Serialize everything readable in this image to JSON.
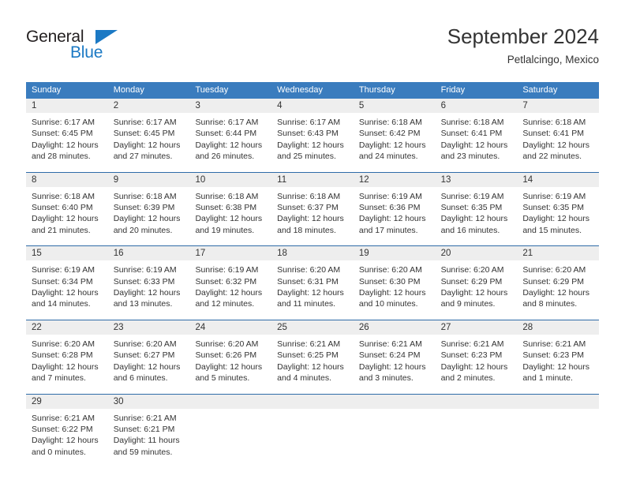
{
  "brand": {
    "name_part1": "General",
    "name_part2": "Blue",
    "logo_icon": "triangle-flag-icon",
    "accent_color": "#1b79c4"
  },
  "header": {
    "title": "September 2024",
    "location": "Petlalcingo, Mexico"
  },
  "calendar": {
    "header_bg_color": "#3a7cbe",
    "day_strip_color": "#eeeeee",
    "weekdays": [
      "Sunday",
      "Monday",
      "Tuesday",
      "Wednesday",
      "Thursday",
      "Friday",
      "Saturday"
    ],
    "weeks": [
      [
        {
          "date": "1",
          "lines": [
            "Sunrise: 6:17 AM",
            "Sunset: 6:45 PM",
            "Daylight: 12 hours",
            "and 28 minutes."
          ]
        },
        {
          "date": "2",
          "lines": [
            "Sunrise: 6:17 AM",
            "Sunset: 6:45 PM",
            "Daylight: 12 hours",
            "and 27 minutes."
          ]
        },
        {
          "date": "3",
          "lines": [
            "Sunrise: 6:17 AM",
            "Sunset: 6:44 PM",
            "Daylight: 12 hours",
            "and 26 minutes."
          ]
        },
        {
          "date": "4",
          "lines": [
            "Sunrise: 6:17 AM",
            "Sunset: 6:43 PM",
            "Daylight: 12 hours",
            "and 25 minutes."
          ]
        },
        {
          "date": "5",
          "lines": [
            "Sunrise: 6:18 AM",
            "Sunset: 6:42 PM",
            "Daylight: 12 hours",
            "and 24 minutes."
          ]
        },
        {
          "date": "6",
          "lines": [
            "Sunrise: 6:18 AM",
            "Sunset: 6:41 PM",
            "Daylight: 12 hours",
            "and 23 minutes."
          ]
        },
        {
          "date": "7",
          "lines": [
            "Sunrise: 6:18 AM",
            "Sunset: 6:41 PM",
            "Daylight: 12 hours",
            "and 22 minutes."
          ]
        }
      ],
      [
        {
          "date": "8",
          "lines": [
            "Sunrise: 6:18 AM",
            "Sunset: 6:40 PM",
            "Daylight: 12 hours",
            "and 21 minutes."
          ]
        },
        {
          "date": "9",
          "lines": [
            "Sunrise: 6:18 AM",
            "Sunset: 6:39 PM",
            "Daylight: 12 hours",
            "and 20 minutes."
          ]
        },
        {
          "date": "10",
          "lines": [
            "Sunrise: 6:18 AM",
            "Sunset: 6:38 PM",
            "Daylight: 12 hours",
            "and 19 minutes."
          ]
        },
        {
          "date": "11",
          "lines": [
            "Sunrise: 6:18 AM",
            "Sunset: 6:37 PM",
            "Daylight: 12 hours",
            "and 18 minutes."
          ]
        },
        {
          "date": "12",
          "lines": [
            "Sunrise: 6:19 AM",
            "Sunset: 6:36 PM",
            "Daylight: 12 hours",
            "and 17 minutes."
          ]
        },
        {
          "date": "13",
          "lines": [
            "Sunrise: 6:19 AM",
            "Sunset: 6:35 PM",
            "Daylight: 12 hours",
            "and 16 minutes."
          ]
        },
        {
          "date": "14",
          "lines": [
            "Sunrise: 6:19 AM",
            "Sunset: 6:35 PM",
            "Daylight: 12 hours",
            "and 15 minutes."
          ]
        }
      ],
      [
        {
          "date": "15",
          "lines": [
            "Sunrise: 6:19 AM",
            "Sunset: 6:34 PM",
            "Daylight: 12 hours",
            "and 14 minutes."
          ]
        },
        {
          "date": "16",
          "lines": [
            "Sunrise: 6:19 AM",
            "Sunset: 6:33 PM",
            "Daylight: 12 hours",
            "and 13 minutes."
          ]
        },
        {
          "date": "17",
          "lines": [
            "Sunrise: 6:19 AM",
            "Sunset: 6:32 PM",
            "Daylight: 12 hours",
            "and 12 minutes."
          ]
        },
        {
          "date": "18",
          "lines": [
            "Sunrise: 6:20 AM",
            "Sunset: 6:31 PM",
            "Daylight: 12 hours",
            "and 11 minutes."
          ]
        },
        {
          "date": "19",
          "lines": [
            "Sunrise: 6:20 AM",
            "Sunset: 6:30 PM",
            "Daylight: 12 hours",
            "and 10 minutes."
          ]
        },
        {
          "date": "20",
          "lines": [
            "Sunrise: 6:20 AM",
            "Sunset: 6:29 PM",
            "Daylight: 12 hours",
            "and 9 minutes."
          ]
        },
        {
          "date": "21",
          "lines": [
            "Sunrise: 6:20 AM",
            "Sunset: 6:29 PM",
            "Daylight: 12 hours",
            "and 8 minutes."
          ]
        }
      ],
      [
        {
          "date": "22",
          "lines": [
            "Sunrise: 6:20 AM",
            "Sunset: 6:28 PM",
            "Daylight: 12 hours",
            "and 7 minutes."
          ]
        },
        {
          "date": "23",
          "lines": [
            "Sunrise: 6:20 AM",
            "Sunset: 6:27 PM",
            "Daylight: 12 hours",
            "and 6 minutes."
          ]
        },
        {
          "date": "24",
          "lines": [
            "Sunrise: 6:20 AM",
            "Sunset: 6:26 PM",
            "Daylight: 12 hours",
            "and 5 minutes."
          ]
        },
        {
          "date": "25",
          "lines": [
            "Sunrise: 6:21 AM",
            "Sunset: 6:25 PM",
            "Daylight: 12 hours",
            "and 4 minutes."
          ]
        },
        {
          "date": "26",
          "lines": [
            "Sunrise: 6:21 AM",
            "Sunset: 6:24 PM",
            "Daylight: 12 hours",
            "and 3 minutes."
          ]
        },
        {
          "date": "27",
          "lines": [
            "Sunrise: 6:21 AM",
            "Sunset: 6:23 PM",
            "Daylight: 12 hours",
            "and 2 minutes."
          ]
        },
        {
          "date": "28",
          "lines": [
            "Sunrise: 6:21 AM",
            "Sunset: 6:23 PM",
            "Daylight: 12 hours",
            "and 1 minute."
          ]
        }
      ],
      [
        {
          "date": "29",
          "lines": [
            "Sunrise: 6:21 AM",
            "Sunset: 6:22 PM",
            "Daylight: 12 hours",
            "and 0 minutes."
          ]
        },
        {
          "date": "30",
          "lines": [
            "Sunrise: 6:21 AM",
            "Sunset: 6:21 PM",
            "Daylight: 11 hours",
            "and 59 minutes."
          ]
        },
        {
          "date": "",
          "lines": []
        },
        {
          "date": "",
          "lines": []
        },
        {
          "date": "",
          "lines": []
        },
        {
          "date": "",
          "lines": []
        },
        {
          "date": "",
          "lines": []
        }
      ]
    ]
  }
}
